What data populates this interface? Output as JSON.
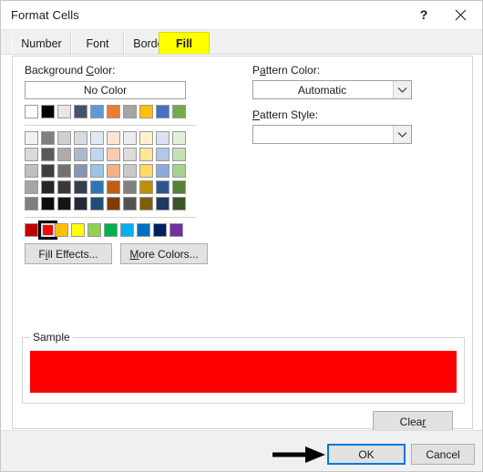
{
  "window": {
    "title": "Format Cells",
    "help_icon": "question-mark-icon",
    "close_icon": "close-x-icon"
  },
  "tabs": [
    {
      "label": "Number",
      "selected": false
    },
    {
      "label": "Font",
      "selected": false
    },
    {
      "label": "Border",
      "selected": false
    },
    {
      "label": "Fill",
      "selected": true
    }
  ],
  "fill_tab": {
    "background_color_label": "Background Color:",
    "background_color_accesskey": "C",
    "no_color_label": "No Color",
    "fill_effects_label": "Fill Effects...",
    "fill_effects_accesskey": "i",
    "more_colors_label": "More Colors...",
    "more_colors_accesskey": "M",
    "pattern_color_label": "Pattern Color:",
    "pattern_color_accesskey": "a",
    "pattern_color_value": "Automatic",
    "pattern_style_label": "Pattern Style:",
    "pattern_style_accesskey": "P",
    "pattern_style_value": "",
    "sample_legend": "Sample",
    "sample_color": "#FF0000",
    "clear_label": "Clear",
    "clear_accesskey": "r",
    "selected_color": "#FF0000",
    "selected_swatch_group": "standard",
    "selected_swatch_index": 1,
    "theme_row": [
      "#FFFFFF",
      "#000000",
      "#E7E6E6",
      "#44546A",
      "#5B9BD5",
      "#ED7D31",
      "#A5A5A5",
      "#FFC000",
      "#4472C4",
      "#70AD47"
    ],
    "variant_rows": [
      [
        "#F2F2F2",
        "#7F7F7F",
        "#D0CECE",
        "#D6DCE4",
        "#DEEBF6",
        "#FBE5D5",
        "#EDEDED",
        "#FFF2CC",
        "#D9E2F3",
        "#E2EFD9"
      ],
      [
        "#D9D9D9",
        "#595959",
        "#AEAAAA",
        "#ACB9CA",
        "#BDD7EE",
        "#F7CBAC",
        "#DBDBDB",
        "#FFE699",
        "#B4C6E7",
        "#C5E0B3"
      ],
      [
        "#BFBFBF",
        "#3F3F3F",
        "#757070",
        "#8496B0",
        "#9CC3E5",
        "#F4B183",
        "#C9C9C9",
        "#FFD965",
        "#8EAADB",
        "#A8D08D"
      ],
      [
        "#A6A6A6",
        "#262626",
        "#3A3838",
        "#333F4F",
        "#2E75B5",
        "#C55A11",
        "#808080",
        "#BF8F00",
        "#2F5496",
        "#538135"
      ],
      [
        "#808080",
        "#0C0C0C",
        "#171616",
        "#222A35",
        "#1F4E79",
        "#833C00",
        "#525252",
        "#7F6000",
        "#1F3864",
        "#375623"
      ]
    ],
    "standard_row": [
      "#C00000",
      "#FF0000",
      "#FFC000",
      "#FFFF00",
      "#92D050",
      "#00B050",
      "#00B0F0",
      "#0070C0",
      "#002060",
      "#7030A0"
    ]
  },
  "footer": {
    "ok_label": "OK",
    "cancel_label": "Cancel"
  },
  "annotation": {
    "arrow_icon": "right-arrow-icon",
    "arrow_color": "#000000",
    "arrow_points_to": "OK",
    "highlight_color": "#FFFF00",
    "highlight_target": "Fill"
  }
}
